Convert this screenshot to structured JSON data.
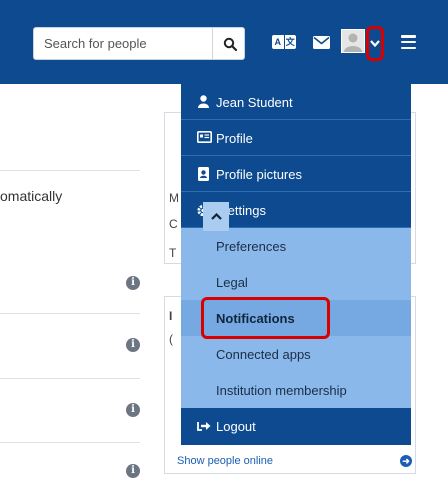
{
  "header": {
    "search_placeholder": "Search for people",
    "lang_icon_left": "A",
    "lang_icon_right": "文"
  },
  "background": {
    "text_fragment": "omatically",
    "card_frags": [
      "M",
      "C",
      "T",
      "I",
      "("
    ],
    "show_people_online": "Show people online"
  },
  "menu": {
    "user_name": "Jean Student",
    "items": [
      {
        "label": "Profile"
      },
      {
        "label": "Profile pictures"
      },
      {
        "label": "Settings"
      },
      {
        "label": "Preferences"
      },
      {
        "label": "Legal"
      },
      {
        "label": "Notifications"
      },
      {
        "label": "Connected apps"
      },
      {
        "label": "Institution membership"
      },
      {
        "label": "Logout"
      }
    ]
  },
  "colors": {
    "header_bg": "#0d4a8f",
    "menu_dark": "#0d4a8f",
    "menu_light": "#8ab8ea",
    "highlight": "#d90000"
  }
}
